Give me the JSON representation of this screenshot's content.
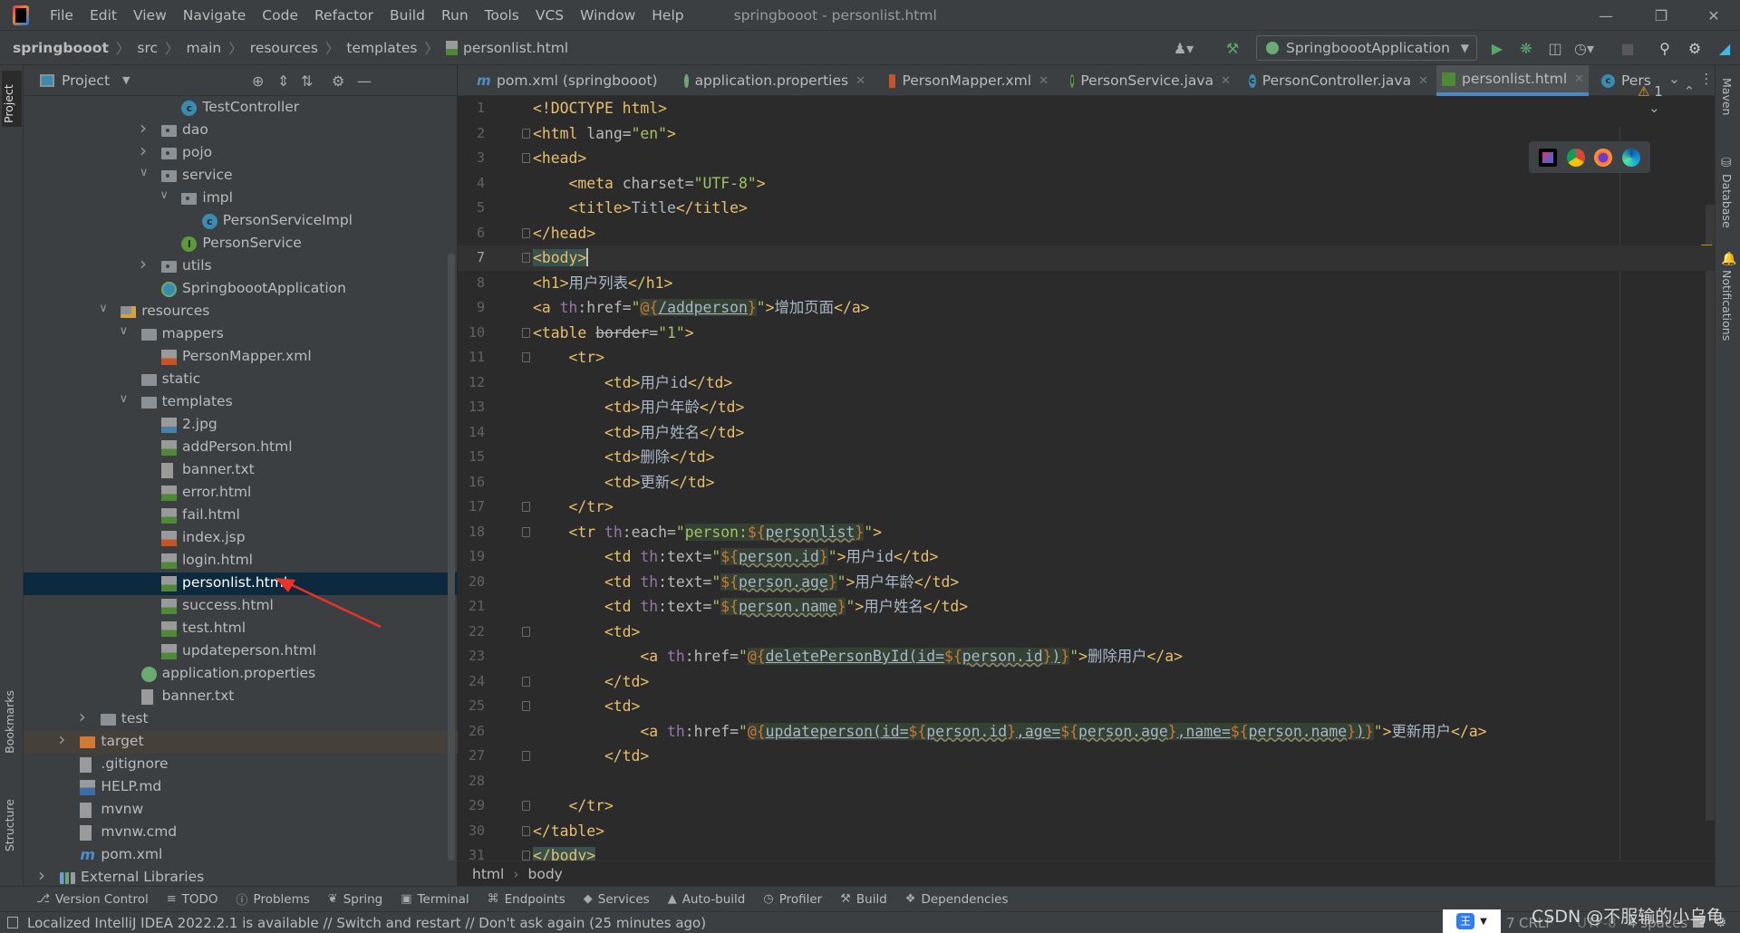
{
  "window": {
    "title": "springbooot - personlist.html",
    "menu": [
      "File",
      "Edit",
      "View",
      "Navigate",
      "Code",
      "Refactor",
      "Build",
      "Run",
      "Tools",
      "VCS",
      "Window",
      "Help"
    ]
  },
  "navbar": {
    "breadcrumb": [
      "springbooot",
      "src",
      "main",
      "resources",
      "templates",
      "personlist.html"
    ],
    "run_config": "SpringboootApplication"
  },
  "stripes": {
    "left": [
      "Project",
      "Bookmarks",
      "Structure"
    ],
    "right": [
      "Maven",
      "Database",
      "Notifications"
    ]
  },
  "project": {
    "title": "Project",
    "tree": [
      {
        "label": "TestController",
        "level": 6,
        "arrow": null,
        "icon": "class"
      },
      {
        "label": "dao",
        "level": 5,
        "arrow": "right",
        "icon": "package-folder"
      },
      {
        "label": "pojo",
        "level": 5,
        "arrow": "right",
        "icon": "package-folder"
      },
      {
        "label": "service",
        "level": 5,
        "arrow": "down",
        "icon": "package-folder"
      },
      {
        "label": "impl",
        "level": 6,
        "arrow": "down",
        "icon": "package-folder"
      },
      {
        "label": "PersonServiceImpl",
        "level": 7,
        "arrow": null,
        "icon": "class"
      },
      {
        "label": "PersonService",
        "level": 6,
        "arrow": null,
        "icon": "interface"
      },
      {
        "label": "utils",
        "level": 5,
        "arrow": "right",
        "icon": "package-folder"
      },
      {
        "label": "SpringboootApplication",
        "level": 5,
        "arrow": null,
        "icon": "spring-app"
      },
      {
        "label": "resources",
        "level": 3,
        "arrow": "down",
        "icon": "resources-folder"
      },
      {
        "label": "mappers",
        "level": 4,
        "arrow": "down",
        "icon": "folder"
      },
      {
        "label": "PersonMapper.xml",
        "level": 5,
        "arrow": null,
        "icon": "xml-file"
      },
      {
        "label": "static",
        "level": 4,
        "arrow": null,
        "icon": "folder"
      },
      {
        "label": "templates",
        "level": 4,
        "arrow": "down",
        "icon": "folder"
      },
      {
        "label": "2.jpg",
        "level": 5,
        "arrow": null,
        "icon": "image-file"
      },
      {
        "label": "addPerson.html",
        "level": 5,
        "arrow": null,
        "icon": "html-file"
      },
      {
        "label": "banner.txt",
        "level": 5,
        "arrow": null,
        "icon": "text-file"
      },
      {
        "label": "error.html",
        "level": 5,
        "arrow": null,
        "icon": "html-file"
      },
      {
        "label": "fail.html",
        "level": 5,
        "arrow": null,
        "icon": "html-file"
      },
      {
        "label": "index.jsp",
        "level": 5,
        "arrow": null,
        "icon": "jsp-file"
      },
      {
        "label": "login.html",
        "level": 5,
        "arrow": null,
        "icon": "html-file"
      },
      {
        "label": "personlist.html",
        "level": 5,
        "arrow": null,
        "icon": "html-file",
        "selected": true
      },
      {
        "label": "success.html",
        "level": 5,
        "arrow": null,
        "icon": "html-file"
      },
      {
        "label": "test.html",
        "level": 5,
        "arrow": null,
        "icon": "html-file"
      },
      {
        "label": "updateperson.html",
        "level": 5,
        "arrow": null,
        "icon": "html-file"
      },
      {
        "label": "application.properties",
        "level": 4,
        "arrow": null,
        "icon": "properties-file"
      },
      {
        "label": "banner.txt",
        "level": 4,
        "arrow": null,
        "icon": "text-file"
      },
      {
        "label": "test",
        "level": 2,
        "arrow": "right",
        "icon": "folder"
      },
      {
        "label": "target",
        "level": 1,
        "arrow": "right",
        "icon": "target-folder",
        "excluded": true
      },
      {
        "label": ".gitignore",
        "level": 1,
        "arrow": null,
        "icon": "gitignore-file"
      },
      {
        "label": "HELP.md",
        "level": 1,
        "arrow": null,
        "icon": "md-file"
      },
      {
        "label": "mvnw",
        "level": 1,
        "arrow": null,
        "icon": "script-file"
      },
      {
        "label": "mvnw.cmd",
        "level": 1,
        "arrow": null,
        "icon": "script-file"
      },
      {
        "label": "pom.xml",
        "level": 1,
        "arrow": null,
        "icon": "maven-file"
      },
      {
        "label": "External Libraries",
        "level": 0,
        "arrow": "right",
        "icon": "libraries"
      }
    ]
  },
  "tabs": [
    {
      "label": "pom.xml (springbooot)",
      "icon": "maven"
    },
    {
      "label": "application.properties",
      "icon": "properties"
    },
    {
      "label": "PersonMapper.xml",
      "icon": "xml"
    },
    {
      "label": "PersonService.java",
      "icon": "interface"
    },
    {
      "label": "PersonController.java",
      "icon": "class"
    },
    {
      "label": "personlist.html",
      "icon": "html",
      "active": true
    },
    {
      "label": "Pers",
      "icon": "class"
    }
  ],
  "editor": {
    "warnings": "1",
    "current_line": 7,
    "lines": [
      [
        [
          "<!DOCTYPE html>",
          "tag"
        ]
      ],
      [
        [
          "<html ",
          "tag"
        ],
        [
          "lang=",
          "attr"
        ],
        [
          "\"en\"",
          "str"
        ],
        [
          ">",
          "tag"
        ]
      ],
      [
        [
          "<head>",
          "tag"
        ]
      ],
      [
        [
          "    <meta ",
          "tag"
        ],
        [
          "charset=",
          "attr"
        ],
        [
          "\"UTF-8\"",
          "str"
        ],
        [
          ">",
          "tag"
        ]
      ],
      [
        [
          "    <title>",
          "tag"
        ],
        [
          "Title",
          "text"
        ],
        [
          "</title>",
          "tag"
        ]
      ],
      [
        [
          "</head>",
          "tag"
        ]
      ],
      [
        [
          "<body>",
          "bodyhl"
        ]
      ],
      [
        [
          "<h1>",
          "tag"
        ],
        [
          "用户列表",
          "text"
        ],
        [
          "</h1>",
          "tag"
        ]
      ],
      [
        [
          "<a ",
          "tag"
        ],
        [
          "th",
          "ns"
        ],
        [
          ":href=",
          "attr"
        ],
        [
          "\"",
          "str"
        ],
        [
          "@{",
          "op"
        ],
        [
          "/addperson",
          "url"
        ],
        [
          "}",
          "op"
        ],
        [
          "\"",
          "str"
        ],
        [
          ">",
          "tag"
        ],
        [
          "增加页面",
          "text"
        ],
        [
          "</a>",
          "tag"
        ]
      ],
      [
        [
          "<table ",
          "tag"
        ],
        [
          "border",
          "dep"
        ],
        [
          "=",
          "attr"
        ],
        [
          "\"1\"",
          "str"
        ],
        [
          ">",
          "tag"
        ]
      ],
      [
        [
          "    <tr>",
          "tag"
        ]
      ],
      [
        [
          "        <td>",
          "tag"
        ],
        [
          "用户id",
          "text"
        ],
        [
          "</td>",
          "tag"
        ]
      ],
      [
        [
          "        <td>",
          "tag"
        ],
        [
          "用户年龄",
          "text"
        ],
        [
          "</td>",
          "tag"
        ]
      ],
      [
        [
          "        <td>",
          "tag"
        ],
        [
          "用户姓名",
          "text"
        ],
        [
          "</td>",
          "tag"
        ]
      ],
      [
        [
          "        <td>",
          "tag"
        ],
        [
          "删除",
          "text"
        ],
        [
          "</td>",
          "tag"
        ]
      ],
      [
        [
          "        <td>",
          "tag"
        ],
        [
          "更新",
          "text"
        ],
        [
          "</td>",
          "tag"
        ]
      ],
      [
        [
          "    </tr>",
          "tag"
        ]
      ],
      [
        [
          "    <tr ",
          "tag"
        ],
        [
          "th",
          "ns"
        ],
        [
          ":each=",
          "attr"
        ],
        [
          "\"",
          "str"
        ],
        [
          "person:",
          "val"
        ],
        [
          "${",
          "op"
        ],
        [
          "personlist",
          "ref"
        ],
        [
          "}",
          "op"
        ],
        [
          "\"",
          "str"
        ],
        [
          ">",
          "tag"
        ]
      ],
      [
        [
          "        <td ",
          "tag"
        ],
        [
          "th",
          "ns"
        ],
        [
          ":text=",
          "attr"
        ],
        [
          "\"",
          "str"
        ],
        [
          "${",
          "op"
        ],
        [
          "person.id",
          "ref"
        ],
        [
          "}",
          "op"
        ],
        [
          "\"",
          "str"
        ],
        [
          ">",
          "tag"
        ],
        [
          "用户id",
          "text"
        ],
        [
          "</td>",
          "tag"
        ]
      ],
      [
        [
          "        <td ",
          "tag"
        ],
        [
          "th",
          "ns"
        ],
        [
          ":text=",
          "attr"
        ],
        [
          "\"",
          "str"
        ],
        [
          "${",
          "op"
        ],
        [
          "person.age",
          "ref"
        ],
        [
          "}",
          "op"
        ],
        [
          "\"",
          "str"
        ],
        [
          ">",
          "tag"
        ],
        [
          "用户年龄",
          "text"
        ],
        [
          "</td>",
          "tag"
        ]
      ],
      [
        [
          "        <td ",
          "tag"
        ],
        [
          "th",
          "ns"
        ],
        [
          ":text=",
          "attr"
        ],
        [
          "\"",
          "str"
        ],
        [
          "${",
          "op"
        ],
        [
          "person.name",
          "ref"
        ],
        [
          "}",
          "op"
        ],
        [
          "\"",
          "str"
        ],
        [
          ">",
          "tag"
        ],
        [
          "用户姓名",
          "text"
        ],
        [
          "</td>",
          "tag"
        ]
      ],
      [
        [
          "        <td>",
          "tag"
        ]
      ],
      [
        [
          "            <a ",
          "tag"
        ],
        [
          "th",
          "ns"
        ],
        [
          ":href=",
          "attr"
        ],
        [
          "\"",
          "str"
        ],
        [
          "@{",
          "op"
        ],
        [
          "deletePersonById(id=",
          "url"
        ],
        [
          "${",
          "op"
        ],
        [
          "person.id",
          "ref"
        ],
        [
          "}",
          "op"
        ],
        [
          ")",
          "url"
        ],
        [
          "}",
          "op"
        ],
        [
          "\"",
          "str"
        ],
        [
          ">",
          "tag"
        ],
        [
          "删除用户",
          "text"
        ],
        [
          "</a>",
          "tag"
        ]
      ],
      [
        [
          "        </td>",
          "tag"
        ]
      ],
      [
        [
          "        <td>",
          "tag"
        ]
      ],
      [
        [
          "            <a ",
          "tag"
        ],
        [
          "th",
          "ns"
        ],
        [
          ":href=",
          "attr"
        ],
        [
          "\"",
          "str"
        ],
        [
          "@{",
          "op"
        ],
        [
          "updateperson(id=",
          "url"
        ],
        [
          "${",
          "op"
        ],
        [
          "person.id",
          "ref"
        ],
        [
          "}",
          "op"
        ],
        [
          ",age=",
          "url"
        ],
        [
          "${",
          "op"
        ],
        [
          "person.age",
          "ref"
        ],
        [
          "}",
          "op"
        ],
        [
          ",name=",
          "url"
        ],
        [
          "${",
          "op"
        ],
        [
          "person.name",
          "ref"
        ],
        [
          "}",
          "op"
        ],
        [
          ")",
          "url"
        ],
        [
          "}",
          "op"
        ],
        [
          "\"",
          "str"
        ],
        [
          ">",
          "tag"
        ],
        [
          "更新用户",
          "text"
        ],
        [
          "</a>",
          "tag"
        ]
      ],
      [
        [
          "        </td>",
          "tag"
        ]
      ],
      [],
      [
        [
          "    </tr>",
          "tag"
        ]
      ],
      [
        [
          "</table>",
          "tag"
        ]
      ],
      [
        [
          "</body>",
          "bodyhl"
        ]
      ]
    ],
    "breadcrumb": [
      "html",
      "body"
    ]
  },
  "toolwindows": [
    "Version Control",
    "TODO",
    "Problems",
    "Spring",
    "Terminal",
    "Endpoints",
    "Services",
    "Auto-build",
    "Profiler",
    "Build",
    "Dependencies"
  ],
  "status": {
    "message": "Localized IntelliJ IDEA 2022.2.1 is available // Switch and restart // Don't ask again (25 minutes ago)",
    "position": "7",
    "line_sep": "CRLF",
    "encoding": "UTF-8",
    "indent": "4 spaces"
  },
  "watermark": "CSDN @不服输的小乌龟"
}
